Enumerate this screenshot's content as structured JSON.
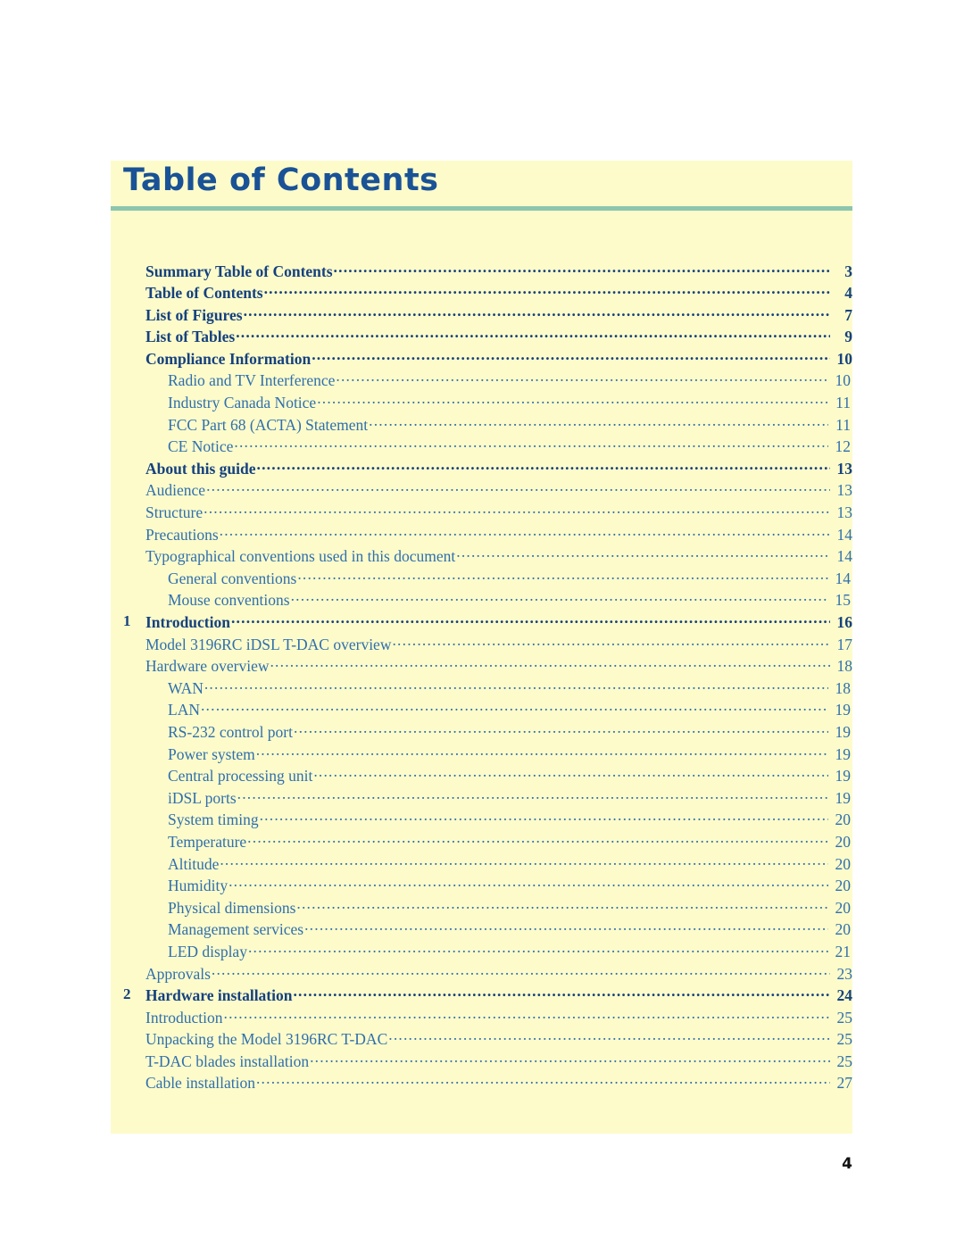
{
  "page": {
    "title": "Table of Contents",
    "folio": "4"
  },
  "toc": {
    "entries": [
      {
        "number": "",
        "label": "Summary Table of Contents",
        "page": "3",
        "level": "top"
      },
      {
        "number": "",
        "label": "Table of Contents",
        "page": "4",
        "level": "top"
      },
      {
        "number": "",
        "label": "List of Figures",
        "page": "7",
        "level": "top"
      },
      {
        "number": "",
        "label": "List of Tables",
        "page": "9",
        "level": "top"
      },
      {
        "number": "",
        "label": "Compliance Information",
        "page": "10",
        "level": "top"
      },
      {
        "number": "",
        "label": "Radio and TV Interference",
        "page": "10",
        "level": "2"
      },
      {
        "number": "",
        "label": "Industry Canada Notice",
        "page": "11",
        "level": "2"
      },
      {
        "number": "",
        "label": "FCC Part 68 (ACTA) Statement",
        "page": "11",
        "level": "2"
      },
      {
        "number": "",
        "label": "CE Notice",
        "page": "12",
        "level": "2"
      },
      {
        "number": "",
        "label": "About this guide",
        "page": "13",
        "level": "top"
      },
      {
        "number": "",
        "label": "Audience",
        "page": "13",
        "level": "1"
      },
      {
        "number": "",
        "label": "Structure",
        "page": "13",
        "level": "1"
      },
      {
        "number": "",
        "label": "Precautions",
        "page": "14",
        "level": "1"
      },
      {
        "number": "",
        "label": "Typographical conventions used in this document",
        "page": "14",
        "level": "1"
      },
      {
        "number": "",
        "label": "General conventions",
        "page": "14",
        "level": "2"
      },
      {
        "number": "",
        "label": "Mouse conventions",
        "page": "15",
        "level": "2"
      },
      {
        "number": "1",
        "label": "Introduction",
        "page": "16",
        "level": "chapter"
      },
      {
        "number": "",
        "label": "Model 3196RC iDSL T-DAC overview",
        "page": "17",
        "level": "1"
      },
      {
        "number": "",
        "label": "Hardware overview",
        "page": "18",
        "level": "1"
      },
      {
        "number": "",
        "label": "WAN",
        "page": "18",
        "level": "2"
      },
      {
        "number": "",
        "label": "LAN",
        "page": "19",
        "level": "2"
      },
      {
        "number": "",
        "label": "RS-232 control port",
        "page": "19",
        "level": "2"
      },
      {
        "number": "",
        "label": "Power system",
        "page": "19",
        "level": "2"
      },
      {
        "number": "",
        "label": "Central processing unit",
        "page": "19",
        "level": "2"
      },
      {
        "number": "",
        "label": "iDSL ports",
        "page": "19",
        "level": "2"
      },
      {
        "number": "",
        "label": "System timing",
        "page": "20",
        "level": "2"
      },
      {
        "number": "",
        "label": "Temperature",
        "page": "20",
        "level": "2"
      },
      {
        "number": "",
        "label": "Altitude",
        "page": "20",
        "level": "2"
      },
      {
        "number": "",
        "label": "Humidity",
        "page": "20",
        "level": "2"
      },
      {
        "number": "",
        "label": "Physical dimensions",
        "page": "20",
        "level": "2"
      },
      {
        "number": "",
        "label": "Management services",
        "page": "20",
        "level": "2"
      },
      {
        "number": "",
        "label": "LED display",
        "page": "21",
        "level": "2"
      },
      {
        "number": "",
        "label": "Approvals",
        "page": "23",
        "level": "1"
      },
      {
        "number": "2",
        "label": "Hardware installation",
        "page": "24",
        "level": "chapter"
      },
      {
        "number": "",
        "label": "Introduction",
        "page": "25",
        "level": "1"
      },
      {
        "number": "",
        "label": "Unpacking the Model 3196RC T-DAC",
        "page": "25",
        "level": "1"
      },
      {
        "number": "",
        "label": "T-DAC blades installation",
        "page": "25",
        "level": "1"
      },
      {
        "number": "",
        "label": "Cable installation",
        "page": "27",
        "level": "1"
      }
    ]
  },
  "colors": {
    "panel_background": "#fdfbca",
    "title_text": "#1a5296",
    "rule": "#8cc6ac",
    "entry_bold": "#15417f",
    "entry_regular": "#2f6fae",
    "folio_text": "#111111"
  }
}
